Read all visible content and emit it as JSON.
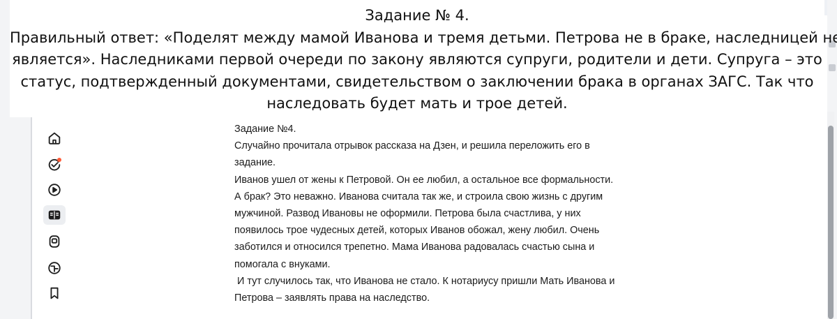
{
  "caption": {
    "lines": [
      "Задание № 4.",
      "Правильный ответ: «Поделят между мамой Иванова и тремя детьми. Петрова не в браке, наследницей не",
      "является». Наследниками первой очереди по закону являются супруги, родители и дети. Супруга – это",
      "статус, подтвержденный документами, свидетельством о заключении брака в органах ЗАГС. Так что",
      "наследовать будет мать и трое детей."
    ]
  },
  "sidebar": {
    "items": [
      {
        "icon": "home-icon",
        "active": false,
        "badge": false
      },
      {
        "icon": "notifications-icon",
        "active": false,
        "badge": true
      },
      {
        "icon": "video-icon",
        "active": false,
        "badge": false
      },
      {
        "icon": "articles-icon",
        "active": true,
        "badge": false
      },
      {
        "icon": "shorts-icon",
        "active": false,
        "badge": false
      },
      {
        "icon": "studio-icon",
        "active": false,
        "badge": false
      },
      {
        "icon": "bookmark-icon",
        "active": false,
        "badge": false
      }
    ],
    "badge_color": "#ff5a36"
  },
  "article": {
    "lines": [
      "Задание №4.",
      "Случайно прочитала отрывок рассказа на Дзен, и решила переложить его в",
      "задание.",
      "Иванов ушел от жены к Петровой. Он ее любил, а остальное все формальности.",
      "А брак? Это неважно. Иванова считала так же, и строила свою жизнь с другим",
      "мужчиной. Развод Ивановы не оформили. Петрова была счастлива, у них",
      "появилось трое чудесных детей, которых Иванов обожал, жену любил. Очень",
      "заботился и относился трепетно. Мама Иванова радовалась счастью сына и",
      "помогала с внуками.",
      " И тут случилось так, что Иванова не стало. К нотариусу пришли Мать Иванова и",
      "Петрова – заявлять права на наследство."
    ]
  }
}
